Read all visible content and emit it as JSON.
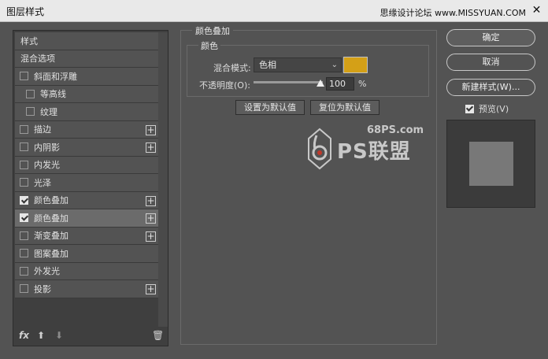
{
  "window": {
    "title": "图层样式",
    "watermark": "思缘设计论坛 www.MISSYUAN.COM",
    "close_glyph": "✕"
  },
  "styles": {
    "items": [
      {
        "label": "样式",
        "kind": "plain"
      },
      {
        "label": "混合选项",
        "kind": "plain"
      },
      {
        "label": "斜面和浮雕",
        "kind": "check",
        "checked": false,
        "plus": false,
        "indent": false
      },
      {
        "label": "等高线",
        "kind": "check",
        "checked": false,
        "plus": false,
        "indent": true
      },
      {
        "label": "纹理",
        "kind": "check",
        "checked": false,
        "plus": false,
        "indent": true
      },
      {
        "label": "描边",
        "kind": "check",
        "checked": false,
        "plus": true,
        "indent": false
      },
      {
        "label": "内阴影",
        "kind": "check",
        "checked": false,
        "plus": true,
        "indent": false
      },
      {
        "label": "内发光",
        "kind": "check",
        "checked": false,
        "plus": false,
        "indent": false
      },
      {
        "label": "光泽",
        "kind": "check",
        "checked": false,
        "plus": false,
        "indent": false
      },
      {
        "label": "颜色叠加",
        "kind": "check",
        "checked": true,
        "plus": true,
        "indent": false
      },
      {
        "label": "颜色叠加",
        "kind": "check",
        "checked": true,
        "plus": true,
        "indent": false,
        "selected": true
      },
      {
        "label": "渐变叠加",
        "kind": "check",
        "checked": false,
        "plus": true,
        "indent": false
      },
      {
        "label": "图案叠加",
        "kind": "check",
        "checked": false,
        "plus": false,
        "indent": false
      },
      {
        "label": "外发光",
        "kind": "check",
        "checked": false,
        "plus": false,
        "indent": false
      },
      {
        "label": "投影",
        "kind": "check",
        "checked": false,
        "plus": true,
        "indent": false
      }
    ],
    "tools": {
      "fx": "fx",
      "up": "⬆",
      "down": "⬇",
      "trash": "🗑"
    }
  },
  "color_overlay": {
    "section_title": "颜色叠加",
    "group_title": "颜色",
    "blend_label": "混合模式:",
    "blend_value": "色相",
    "overlay_color": "#d4a017",
    "opacity_label": "不透明度(O):",
    "opacity_value": "100",
    "opacity_unit": "%",
    "set_default_label": "设置为默认值",
    "reset_default_label": "复位为默认值"
  },
  "logo": {
    "site": "68PS.com",
    "brand": "PS联盟"
  },
  "actions": {
    "ok_label": "确定",
    "cancel_label": "取消",
    "new_style_label": "新建样式(W)...",
    "preview_label": "预览(V)"
  }
}
